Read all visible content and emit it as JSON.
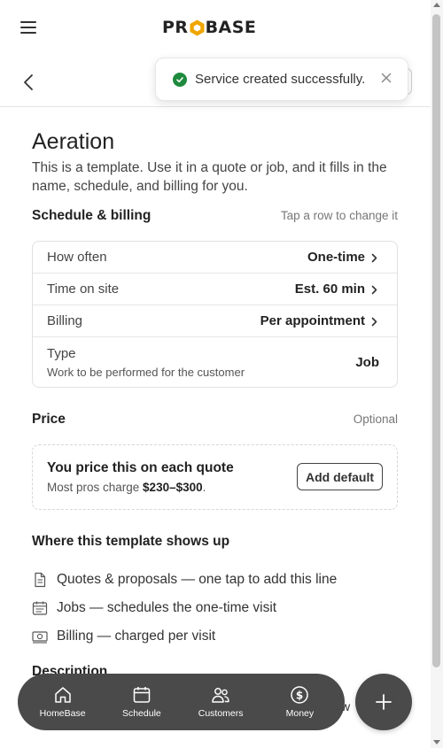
{
  "header": {
    "logo_left": "PR",
    "logo_right": "BASE"
  },
  "toast": {
    "message": "Service created successfully.",
    "accent_color": "#1f8a3d"
  },
  "template": {
    "title": "Aeration",
    "intro": "This is a template. Use it in a quote or job, and it fills in the name, schedule, and billing for you."
  },
  "schedule": {
    "heading": "Schedule & billing",
    "hint": "Tap a row to change it",
    "rows": [
      {
        "label": "How often",
        "value": "One-time"
      },
      {
        "label": "Time on site",
        "value": "Est. 60 min"
      },
      {
        "label": "Billing",
        "value": "Per appointment"
      },
      {
        "label": "Type",
        "sub": "Work to be performed for the customer",
        "value": "Job"
      }
    ]
  },
  "price": {
    "heading": "Price",
    "hint": "Optional",
    "box_title": "You price this on each quote",
    "box_sub_prefix": "Most pros charge ",
    "box_sub_range": "$230–$300",
    "box_sub_suffix": ".",
    "add_default_label": "Add default"
  },
  "shows_up": {
    "heading": "Where this template shows up",
    "items": [
      {
        "icon": "document-icon",
        "text": "Quotes & proposals — one tap to add this line"
      },
      {
        "icon": "calendar-icon",
        "text": "Jobs — schedules the one-time visit"
      },
      {
        "icon": "cash-icon",
        "text": "Billing — charged per visit"
      }
    ]
  },
  "description": {
    "heading": "Description",
    "peek": "w"
  },
  "bottom_nav": {
    "items": [
      {
        "icon": "home-icon",
        "label": "HomeBase"
      },
      {
        "icon": "calendar-icon",
        "label": "Schedule"
      },
      {
        "icon": "users-icon",
        "label": "Customers"
      },
      {
        "icon": "dollar-icon",
        "label": "Money"
      }
    ],
    "fab_icon": "plus-icon",
    "bg_color": "#4a4a4a"
  }
}
